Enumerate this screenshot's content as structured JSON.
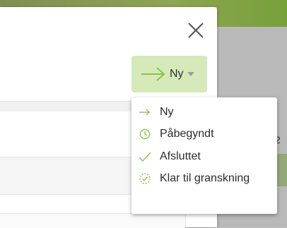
{
  "status_button": {
    "label": "Ny",
    "icon": "arrow-right-icon"
  },
  "close_icon": "close-icon",
  "menu": {
    "items": [
      {
        "label": "Ny",
        "icon": "arrow-right-icon"
      },
      {
        "label": "Påbegyndt",
        "icon": "clock-icon"
      },
      {
        "label": "Afsluttet",
        "icon": "checkmark-icon"
      },
      {
        "label": "Klar til granskning",
        "icon": "dashed-check-circle-icon"
      }
    ]
  },
  "background": {
    "partial_number": "2"
  },
  "colors": {
    "accent": "#8bc34a",
    "button_bg": "#d5eab8",
    "topbar": "#8ea552"
  }
}
